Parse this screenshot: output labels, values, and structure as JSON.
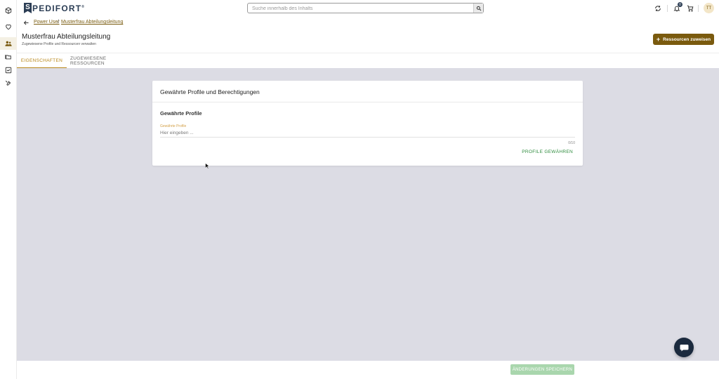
{
  "app": {
    "logo_letter": "S",
    "logo_text": "PEDIFORT",
    "logo_mark": "®",
    "accent_color": "#7a5a0e",
    "tab_accent_color": "#b8871a",
    "success_color": "#2e8b3d"
  },
  "sidebar": {
    "items": [
      {
        "icon": "package-icon"
      },
      {
        "icon": "heart-icon"
      },
      {
        "icon": "users-icon",
        "active": true
      },
      {
        "icon": "folders-icon"
      },
      {
        "icon": "report-icon"
      },
      {
        "icon": "tools-icon"
      }
    ]
  },
  "topbar": {
    "search_placeholder": "Suche innerhalb des Inhalts",
    "notification_count": "0",
    "avatar_initials": "TT"
  },
  "breadcrumb": {
    "items": [
      "Power User",
      "Musterfrau Abteilungsleitung"
    ],
    "separator": "/"
  },
  "header": {
    "title": "Musterfrau Abteilungsleitung",
    "subtitle": "Zugewiesene Profile und Ressourcen verwalten",
    "assign_button": "Ressourcen zuweisen"
  },
  "tabs": [
    {
      "label": "EIGENSCHAFTEN",
      "active": true
    },
    {
      "label": "ZUGEWIESENE RESSOURCEN",
      "active": false
    }
  ],
  "card": {
    "title": "Gewährte Profile und Berechtigungen",
    "section_title": "Gewährte Profile",
    "field_label": "Gewährte Profile",
    "field_placeholder": "Hier eingeben ...",
    "counter": "0/10",
    "grant_button": "PROFILE GEWÄHREN"
  },
  "footer": {
    "save_button": "ÄNDERUNGEN SPEICHERN"
  }
}
